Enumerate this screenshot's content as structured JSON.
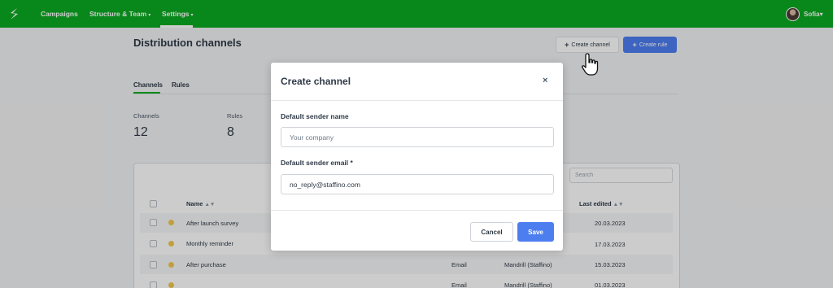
{
  "nav": {
    "items": [
      {
        "label": "Campaigns"
      },
      {
        "label": "Structure & Team"
      },
      {
        "label": "Settings"
      }
    ],
    "caret": "▾",
    "user_name": "Sofia"
  },
  "page": {
    "title": "Distribution channels",
    "create_channel_label": "Create channel",
    "create_rule_label": "Create rule",
    "plus": "+",
    "tabs": [
      {
        "label": "Channels",
        "active": true
      },
      {
        "label": "Rules",
        "active": false
      }
    ],
    "stats": [
      {
        "label": "Channels",
        "value": "12"
      },
      {
        "label": "Rules",
        "value": "8"
      }
    ]
  },
  "table": {
    "search_placeholder": "Search",
    "headers": {
      "name": "Name",
      "name_sort": "▲▼",
      "last_edited": "Last edited",
      "last_edited_sort": "▲▼"
    },
    "rows": [
      {
        "name": "After launch survey",
        "type": "",
        "provider": "",
        "date": "20.03.2023"
      },
      {
        "name": "Monthly reminder",
        "type": "",
        "provider": "",
        "date": "17.03.2023"
      },
      {
        "name": "After purchase",
        "type": "Email",
        "provider": "Mandrill (Staffino)",
        "date": "15.03.2023"
      },
      {
        "name": "",
        "type": "Email",
        "provider": "Mandrill (Staffino)",
        "date": "01.03.2023"
      }
    ]
  },
  "modal": {
    "title": "Create channel",
    "close": "×",
    "sender_name_label": "Default sender name",
    "sender_name_placeholder": "Your company",
    "sender_email_label": "Default sender email *",
    "sender_email_value": "no_reply@staffino.com",
    "cancel_label": "Cancel",
    "save_label": "Save"
  },
  "colors": {
    "brand_green": "#0aab21",
    "primary_blue": "#4d7ef0",
    "status_dot": "#f2c94c"
  }
}
